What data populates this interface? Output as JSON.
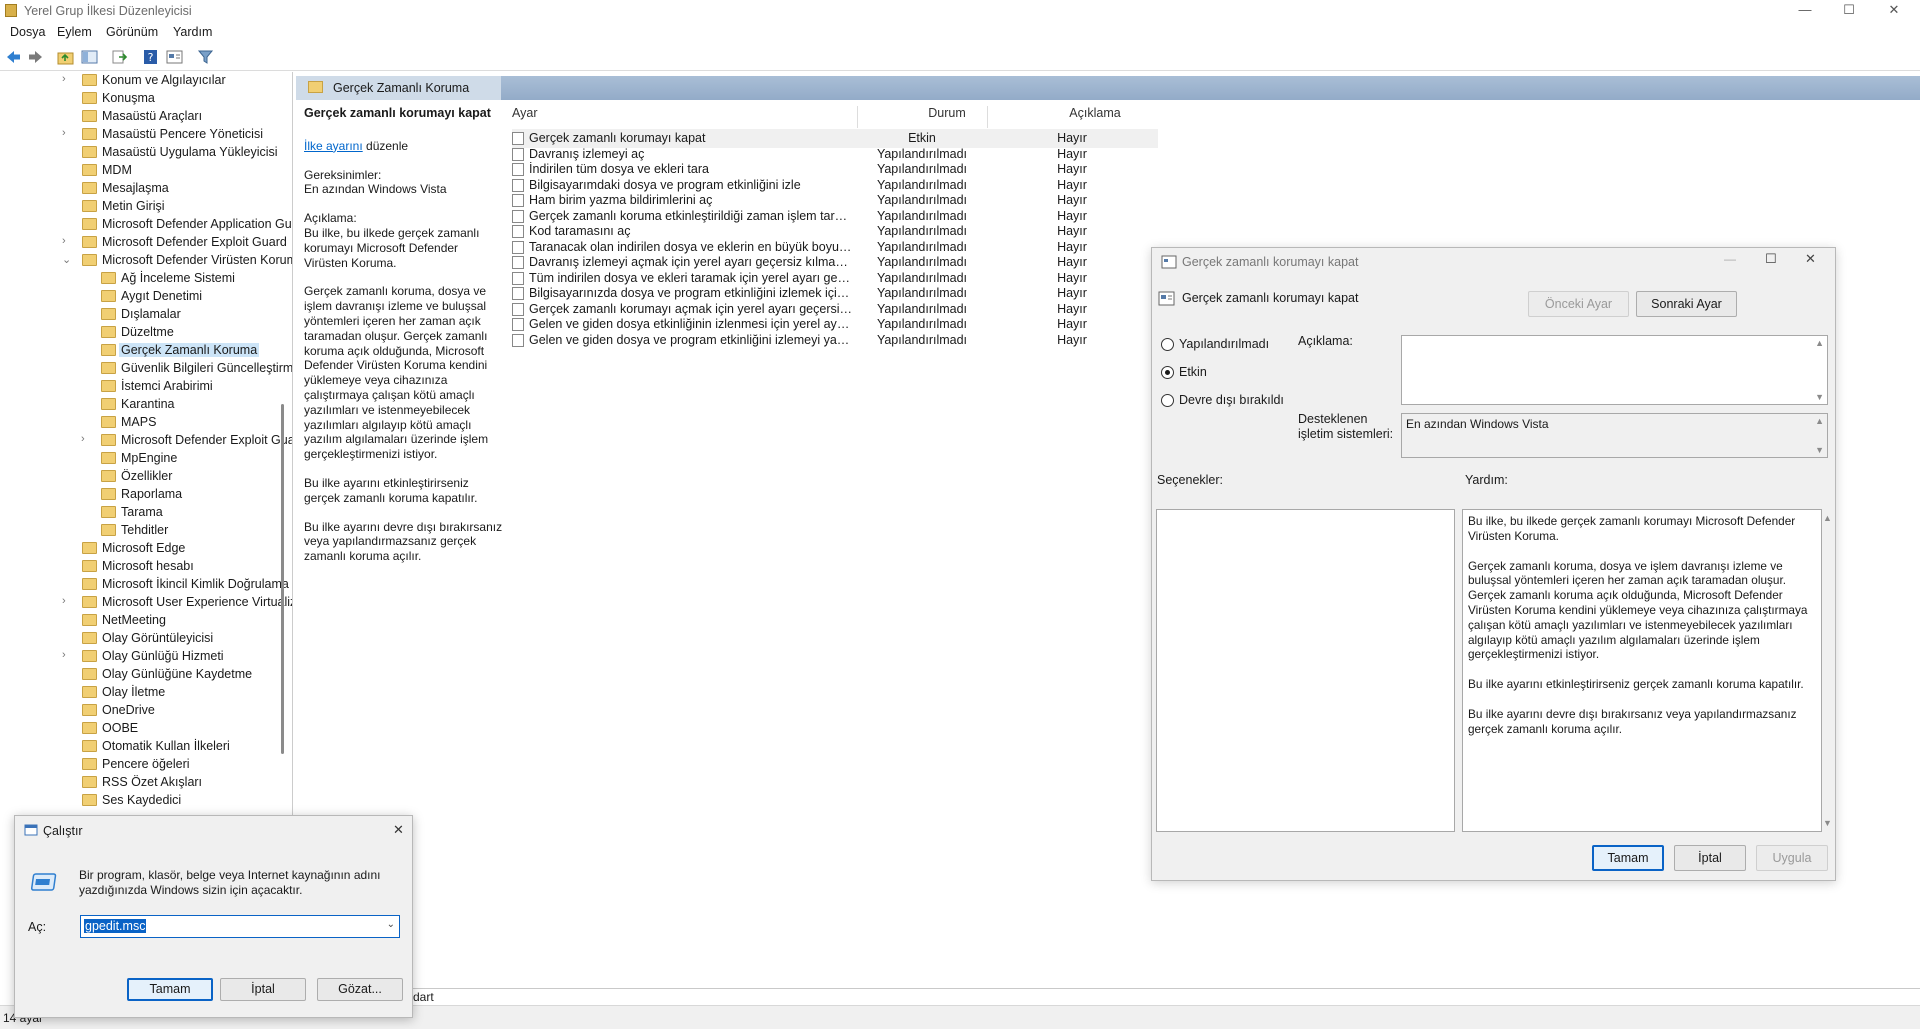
{
  "app": {
    "title": "Yerel Grup İlkesi Düzenleyicisi",
    "controls": {
      "minimize": "—",
      "maximize": "☐",
      "close": "✕"
    }
  },
  "menu": [
    "Dosya",
    "Eylem",
    "Görünüm",
    "Yardım"
  ],
  "toolbar_icons": [
    "back-icon",
    "forward-icon",
    "up-folder-icon",
    "show-hide-tree-icon",
    "export-list-icon",
    "help-icon",
    "properties-icon",
    "filter-icon"
  ],
  "tree": [
    {
      "label": "Konum ve Algılayıcılar",
      "expand": "›"
    },
    {
      "label": "Konuşma"
    },
    {
      "label": "Masaüstü Araçları"
    },
    {
      "label": "Masaüstü Pencere Yöneticisi",
      "expand": "›"
    },
    {
      "label": "Masaüstü Uygulama Yükleyicisi"
    },
    {
      "label": "MDM"
    },
    {
      "label": "Mesajlaşma"
    },
    {
      "label": "Metin Girişi"
    },
    {
      "label": "Microsoft Defender Application Guard"
    },
    {
      "label": "Microsoft Defender Exploit Guard",
      "expand": "›"
    },
    {
      "label": "Microsoft Defender Virüsten Koruma",
      "expand": "⌄"
    },
    {
      "label": "Ağ İnceleme Sistemi",
      "indent": true
    },
    {
      "label": "Aygıt Denetimi",
      "indent": true
    },
    {
      "label": "Dışlamalar",
      "indent": true
    },
    {
      "label": "Düzeltme",
      "indent": true
    },
    {
      "label": "Gerçek Zamanlı Koruma",
      "indent": true,
      "selected": true
    },
    {
      "label": "Güvenlik Bilgileri Güncelleştirmeleri",
      "indent": true
    },
    {
      "label": "İstemci Arabirimi",
      "indent": true
    },
    {
      "label": "Karantina",
      "indent": true
    },
    {
      "label": "MAPS",
      "indent": true
    },
    {
      "label": "Microsoft Defender Exploit Guard",
      "indent": true,
      "expand": "›"
    },
    {
      "label": "MpEngine",
      "indent": true
    },
    {
      "label": "Özellikler",
      "indent": true
    },
    {
      "label": "Raporlama",
      "indent": true
    },
    {
      "label": "Tarama",
      "indent": true
    },
    {
      "label": "Tehditler",
      "indent": true
    },
    {
      "label": "Microsoft Edge"
    },
    {
      "label": "Microsoft hesabı"
    },
    {
      "label": "Microsoft İkincil Kimlik Doğrulama Faktörü"
    },
    {
      "label": "Microsoft User Experience Virtualization",
      "expand": "›"
    },
    {
      "label": "NetMeeting"
    },
    {
      "label": "Olay Görüntüleyicisi"
    },
    {
      "label": "Olay Günlüğü Hizmeti",
      "expand": "›"
    },
    {
      "label": "Olay Günlüğüne Kaydetme"
    },
    {
      "label": "Olay İletme"
    },
    {
      "label": "OneDrive"
    },
    {
      "label": "OOBE"
    },
    {
      "label": "Otomatik Kullan İlkeleri"
    },
    {
      "label": "Pencere öğeleri"
    },
    {
      "label": "RSS Özet Akışları"
    },
    {
      "label": "Ses Kaydedici"
    }
  ],
  "pane": {
    "header": "Gerçek Zamanlı Koruma",
    "desc": {
      "title": "Gerçek zamanlı korumayı kapat",
      "link": "İlke ayarını",
      "link_suffix": " düzenle",
      "req_label": "Gereksinimler:",
      "req_value": "En azından Windows Vista",
      "desc_label": "Açıklama:",
      "p1": "Bu ilke, bu ilkede gerçek zamanlı korumayı Microsoft Defender Virüsten Koruma.",
      "p2": "Gerçek zamanlı koruma, dosya ve işlem davranışı izleme ve buluşsal yöntemleri içeren her zaman açık taramadan oluşur. Gerçek zamanlı koruma açık olduğunda, Microsoft Defender Virüsten Koruma kendini yüklemeye veya cihazınıza çalıştırmaya çalışan kötü amaçlı yazılımları ve istenmeyebilecek yazılımları algılayıp kötü amaçlı yazılım algılamaları üzerinde işlem gerçekleştirmenizi istiyor.",
      "p3": "Bu ilke ayarını etkinleştirirseniz gerçek zamanlı koruma kapatılır.",
      "p4": "Bu ilke ayarını devre dışı bırakırsanız veya yapılandırmazsanız gerçek zamanlı koruma açılır."
    },
    "columns": {
      "name": "Ayar",
      "state": "Durum",
      "desc": "Açıklama"
    },
    "rows": [
      {
        "name": "Gerçek zamanlı korumayı kapat",
        "state": "Etkin",
        "desc": "Hayır"
      },
      {
        "name": "Davranış izlemeyi aç",
        "state": "Yapılandırılmadı",
        "desc": "Hayır"
      },
      {
        "name": "İndirilen tüm dosya ve ekleri tara",
        "state": "Yapılandırılmadı",
        "desc": "Hayır"
      },
      {
        "name": "Bilgisayarımdaki dosya ve program etkinliğini izle",
        "state": "Yapılandırılmadı",
        "desc": "Hayır"
      },
      {
        "name": "Ham birim yazma bildirimlerini aç",
        "state": "Yapılandırılmadı",
        "desc": "Hayır"
      },
      {
        "name": "Gerçek zamanlı koruma etkinleştirildiği zaman işlem tarama...",
        "state": "Yapılandırılmadı",
        "desc": "Hayır"
      },
      {
        "name": "Kod taramasını aç",
        "state": "Yapılandırılmadı",
        "desc": "Hayır"
      },
      {
        "name": "Taranacak olan indirilen dosya ve eklerin en büyük boyutun...",
        "state": "Yapılandırılmadı",
        "desc": "Hayır"
      },
      {
        "name": "Davranış izlemeyi açmak için yerel ayarı geçersiz kılmayı yap...",
        "state": "Yapılandırılmadı",
        "desc": "Hayır"
      },
      {
        "name": "Tüm indirilen dosya ve ekleri taramak için yerel ayarı geçersi...",
        "state": "Yapılandırılmadı",
        "desc": "Hayır"
      },
      {
        "name": "Bilgisayarınızda dosya ve program etkinliğini izlemek için ye...",
        "state": "Yapılandırılmadı",
        "desc": "Hayır"
      },
      {
        "name": "Gerçek zamanlı korumayı açmak için yerel ayarı geçersiz kıl...",
        "state": "Yapılandırılmadı",
        "desc": "Hayır"
      },
      {
        "name": "Gelen ve giden dosya etkinliğinin izlenmesi için yerel ayarı g...",
        "state": "Yapılandırılmadı",
        "desc": "Hayır"
      },
      {
        "name": "Gelen ve giden dosya ve program etkinliğini izlemeyi yapıla...",
        "state": "Yapılandırılmadı",
        "desc": "Hayır"
      }
    ]
  },
  "status": {
    "text": "14 ayar",
    "tab": "dart"
  },
  "policy_dialog": {
    "title": "Gerçek zamanlı korumayı kapat",
    "setting_name": "Gerçek zamanlı korumayı kapat",
    "prev": "Önceki Ayar",
    "next": "Sonraki Ayar",
    "options": [
      "Yapılandırılmadı",
      "Etkin",
      "Devre dışı bırakıldı"
    ],
    "selected_option": "Etkin",
    "comment_label": "Açıklama:",
    "supported_label_1": "Desteklenen",
    "supported_label_2": "işletim sistemleri:",
    "supported_value": "En azından Windows Vista",
    "options_label": "Seçenekler:",
    "help_label": "Yardım:",
    "help_p1": "Bu ilke, bu ilkede gerçek zamanlı korumayı Microsoft Defender Virüsten Koruma.",
    "help_p2": "Gerçek zamanlı koruma, dosya ve işlem davranışı izleme ve buluşsal yöntemleri içeren her zaman açık taramadan oluşur. Gerçek zamanlı koruma açık olduğunda, Microsoft Defender Virüsten Koruma kendini yüklemeye veya cihazınıza çalıştırmaya çalışan kötü amaçlı yazılımları ve istenmeyebilecek yazılımları algılayıp kötü amaçlı yazılım algılamaları üzerinde işlem gerçekleştirmenizi istiyor.",
    "help_p3": "Bu ilke ayarını etkinleştirirseniz gerçek zamanlı koruma kapatılır.",
    "help_p4": "Bu ilke ayarını devre dışı bırakırsanız veya yapılandırmazsanız gerçek zamanlı koruma açılır.",
    "ok": "Tamam",
    "cancel": "İptal",
    "apply": "Uygula"
  },
  "run_dialog": {
    "title": "Çalıştır",
    "message": "Bir program, klasör, belge veya Internet kaynağının adını yazdığınızda Windows sizin için açacaktır.",
    "open_label": "Aç:",
    "value": "gpedit.msc",
    "ok": "Tamam",
    "cancel": "İptal",
    "browse": "Gözat..."
  },
  "colors": {
    "accent": "#0a63c6",
    "header": "#a9bed6",
    "selection": "#cce4f7",
    "folder": "#f1cf73"
  }
}
